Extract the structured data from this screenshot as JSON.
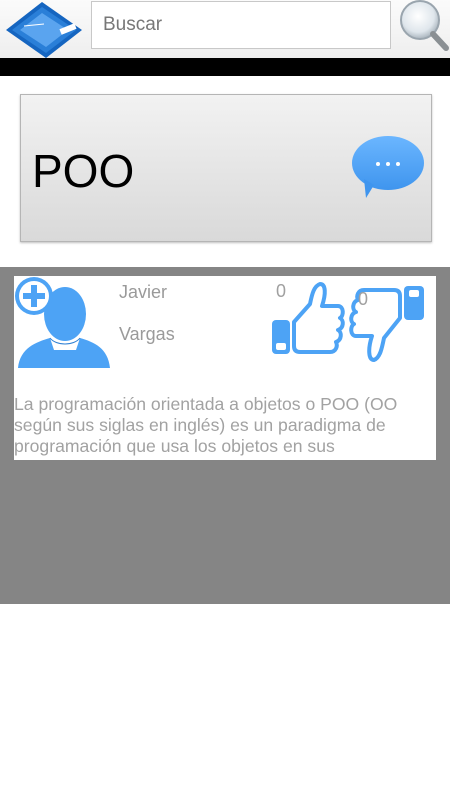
{
  "search": {
    "placeholder": "Buscar"
  },
  "header": {
    "title": "POO"
  },
  "post": {
    "author_first": "Javier",
    "author_last": "Vargas",
    "likes": "0",
    "dislikes": "0",
    "body_lines": [
      "La programación orientada a objetos o POO (OO",
      "según sus siglas en inglés) es un paradigma de",
      "programación que usa los objetos en sus"
    ]
  },
  "colors": {
    "accent_blue": "#4da3f5",
    "feed_gray": "#858585",
    "black_band": "#000000"
  },
  "icons": {
    "logo": "app-logo-icon",
    "search": "magnifier-icon",
    "chat": "chat-bubble-icon",
    "avatar": "add-user-icon",
    "like": "thumbs-up-icon",
    "dislike": "thumbs-down-icon"
  }
}
